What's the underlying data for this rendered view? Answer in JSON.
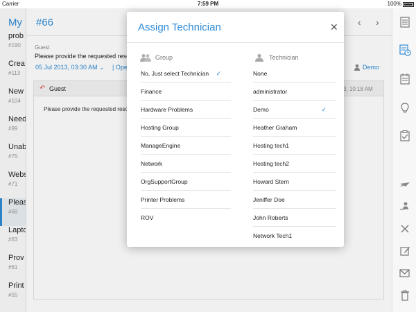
{
  "status_bar": {
    "carrier": "Carrier",
    "time": "7:59 PM",
    "battery": "100%"
  },
  "list": {
    "title": "My",
    "items": [
      {
        "title": "prob",
        "num": "#190"
      },
      {
        "title": "Crea",
        "num": "#113"
      },
      {
        "title": "New",
        "num": "#104"
      },
      {
        "title": "Need",
        "num": "#99"
      },
      {
        "title": "Unab",
        "num": "#75"
      },
      {
        "title": "Webs",
        "num": "#71"
      },
      {
        "title": "Pleas",
        "num": "#66"
      },
      {
        "title": "Lapto",
        "num": "#63"
      },
      {
        "title": "Prov",
        "num": "#61"
      },
      {
        "title": "Print",
        "num": "#55"
      }
    ]
  },
  "request": {
    "number": "#66",
    "from": "Guest",
    "subject": "Please provide the requested reso",
    "date": "05 Jul 2013, 03:30 AM",
    "status": "| Oper",
    "technician": "Demo",
    "message": {
      "sender": "Guest",
      "time": "3, 10:18 AM",
      "body": "Please provide the requested resour"
    }
  },
  "modal": {
    "title": "Assign Technician",
    "group_header": "Group",
    "technician_header": "Technician",
    "groups": [
      "No, Just select Technician",
      "Finance",
      "Hardware Problems",
      "Hosting Group",
      "ManageEngine",
      "Network",
      "OrgSupportGroup",
      "Printer Problems",
      "ROV"
    ],
    "selected_group": "No, Just select Technician",
    "technicians": [
      "None",
      "administrator",
      "Demo",
      "Heather Graham",
      "Hosting tech1",
      "Hosting tech2",
      "Howard Stern",
      "Jeniffer Doe",
      "John Roberts",
      "Network Tech1"
    ],
    "selected_technician": "Demo"
  },
  "colors": {
    "accent": "#2e8bd6",
    "reply": "#e24a4a"
  },
  "toolbar_icons": [
    "details-icon",
    "history-icon",
    "tasks-icon",
    "solution-icon",
    "checklist-icon",
    "pickup-icon",
    "assign-icon",
    "close-request-icon",
    "edit-icon",
    "reply-icon",
    "delete-icon"
  ]
}
